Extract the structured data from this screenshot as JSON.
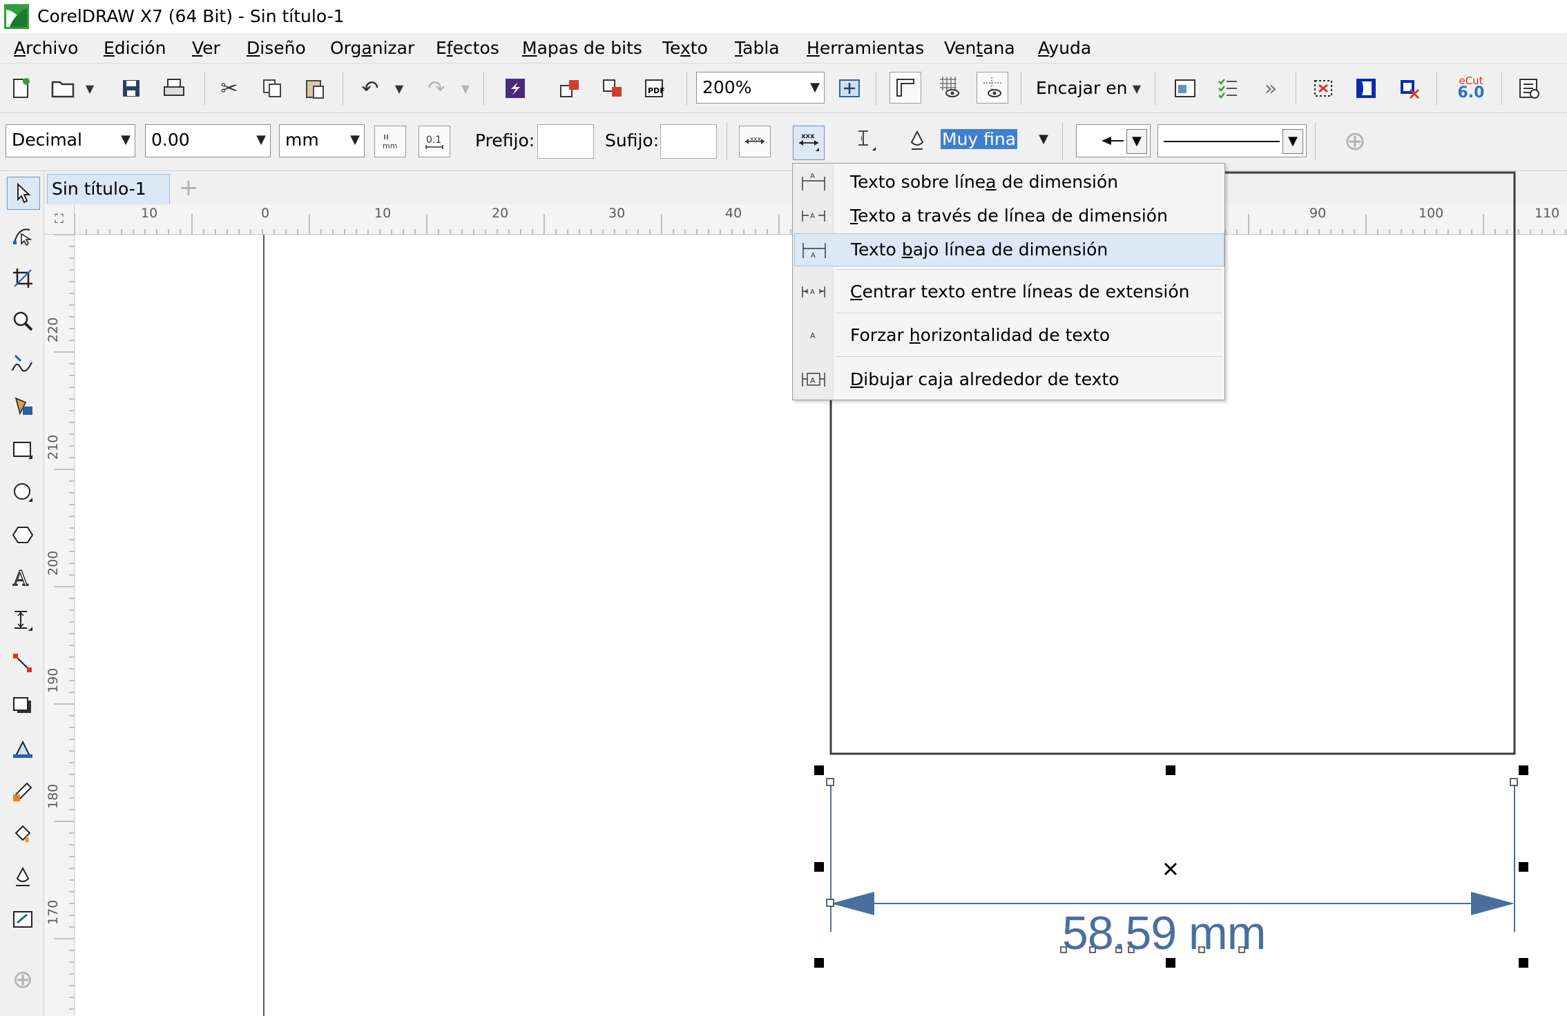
{
  "window": {
    "title": "CorelDRAW X7 (64 Bit) - Sin título-1"
  },
  "menu": [
    {
      "label": "Archivo",
      "u": 0
    },
    {
      "label": "Edición",
      "u": 0
    },
    {
      "label": "Ver",
      "u": 0
    },
    {
      "label": "Diseño",
      "u": 0
    },
    {
      "label": "Organizar",
      "u": 3
    },
    {
      "label": "Efectos",
      "u": 1
    },
    {
      "label": "Mapas de bits",
      "u": 0
    },
    {
      "label": "Texto",
      "u": 2
    },
    {
      "label": "Tabla",
      "u": 0
    },
    {
      "label": "Herramientas",
      "u": 0
    },
    {
      "label": "Ventana",
      "u": 3
    },
    {
      "label": "Ayuda",
      "u": 0
    }
  ],
  "toolbar": {
    "zoom": "200%",
    "fit_label": "Encajar en",
    "ecut_label": "eCut",
    "ecut_version": "6.0"
  },
  "property_bar": {
    "style": "Decimal",
    "precision": "0.00",
    "units": "mm",
    "prefix_label": "Prefijo:",
    "suffix_label": "Sufijo:",
    "prefix_value": "",
    "suffix_value": "",
    "outline_width": "Muy fina"
  },
  "document": {
    "tab": "Sin título-1",
    "dimension_text": "58.59 mm"
  },
  "rulers": {
    "horizontal": [
      "10",
      "0",
      "10",
      "20",
      "30",
      "40",
      "90",
      "100",
      "110"
    ],
    "vertical": [
      "220",
      "210",
      "200",
      "190",
      "180",
      "170"
    ]
  },
  "dimension_menu": {
    "items": [
      {
        "label": "Texto sobre línea de dimensión",
        "pre": "Texto sobre líne",
        "key": "a",
        "post": " de dimensión",
        "highlight": false
      },
      {
        "label": "Texto a través de línea de dimensión",
        "pre": "",
        "key": "T",
        "post": "exto a través de línea de dimensión",
        "highlight": false
      },
      {
        "label": "Texto bajo línea de dimensión",
        "pre": "Texto ",
        "key": "b",
        "post": "ajo línea de dimensión",
        "highlight": true
      },
      {
        "label": "Centrar texto entre líneas de extensión",
        "pre": "",
        "key": "C",
        "post": "entrar texto entre líneas de extensión",
        "highlight": false
      },
      {
        "label": "Forzar horizontalidad de texto",
        "pre": "Forzar ",
        "key": "h",
        "post": "orizontalidad de texto",
        "highlight": false
      },
      {
        "label": "Dibujar caja alrededor de texto",
        "pre": "",
        "key": "D",
        "post": "ibujar caja alrededor de texto",
        "highlight": false
      }
    ]
  }
}
